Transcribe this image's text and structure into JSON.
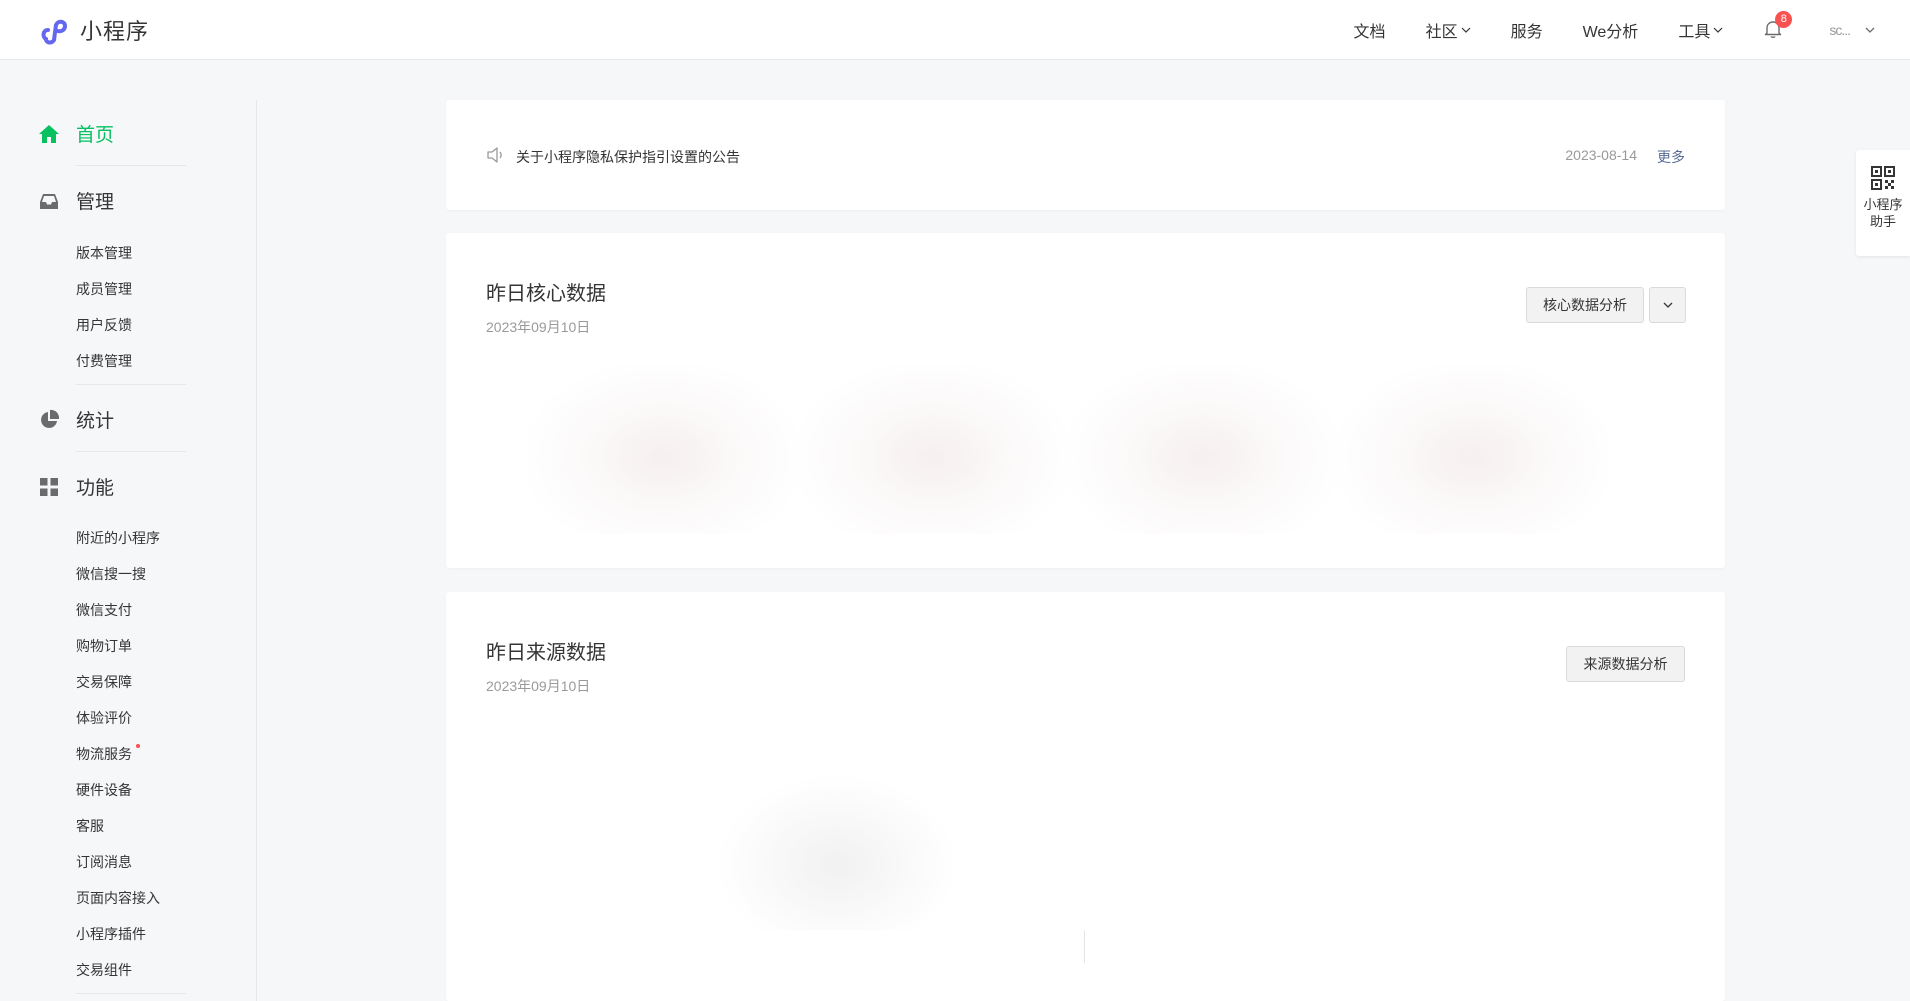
{
  "brand": {
    "name": "小程序"
  },
  "nav": {
    "items": [
      {
        "label": "文档",
        "dropdown": false
      },
      {
        "label": "社区",
        "dropdown": true
      },
      {
        "label": "服务",
        "dropdown": false
      },
      {
        "label": "We分析",
        "dropdown": false
      },
      {
        "label": "工具",
        "dropdown": true
      }
    ],
    "notification_count": "8",
    "user_name": "sc..."
  },
  "sidebar": {
    "home": "首页",
    "manage": "管理",
    "manage_items": [
      "版本管理",
      "成员管理",
      "用户反馈",
      "付费管理"
    ],
    "stats": "统计",
    "features": "功能",
    "feature_items": [
      "附近的小程序",
      "微信搜一搜",
      "微信支付",
      "购物订单",
      "交易保障",
      "体验评价",
      "物流服务",
      "硬件设备",
      "客服",
      "订阅消息",
      "页面内容接入",
      "小程序插件",
      "交易组件"
    ]
  },
  "notice": {
    "text": "关于小程序隐私保护指引设置的公告",
    "date": "2023-08-14",
    "more": "更多"
  },
  "core": {
    "title": "昨日核心数据",
    "date": "2023年09月10日",
    "analysis_button": "核心数据分析"
  },
  "source": {
    "title": "昨日来源数据",
    "date": "2023年09月10日",
    "analysis_button": "来源数据分析"
  },
  "helper": {
    "label": "小程序助手"
  },
  "colors": {
    "accent": "#07c160",
    "link": "#576b95",
    "badge": "#fa5151",
    "text": "#353535",
    "muted": "#9a9a9a"
  }
}
